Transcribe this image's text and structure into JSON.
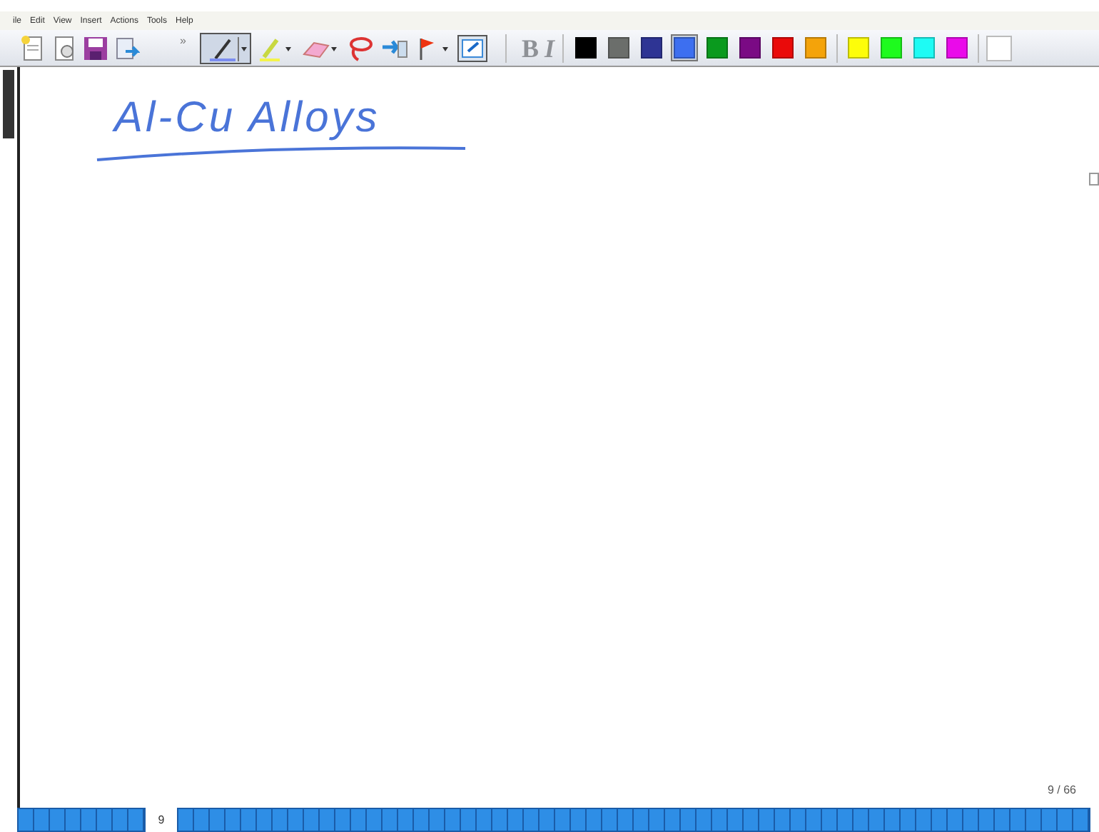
{
  "menu": [
    "ile",
    "Edit",
    "View",
    "Insert",
    "Actions",
    "Tools",
    "Help"
  ],
  "toolbar": {
    "overflow": "»",
    "pen_selected": true,
    "bold": "B",
    "italic": "I"
  },
  "palette": [
    {
      "color": "#000000",
      "selected": false
    },
    {
      "color": "#6b6e6b",
      "selected": false
    },
    {
      "color": "#2e3494",
      "selected": false
    },
    {
      "color": "#3d6ff0",
      "selected": true
    },
    {
      "color": "#0a9a1e",
      "selected": false
    },
    {
      "color": "#7a0a84",
      "selected": false
    },
    {
      "color": "#ea0a0a",
      "selected": false
    },
    {
      "color": "#f4a30a",
      "selected": false
    },
    {
      "color": "#fdfd0a",
      "selected": false
    },
    {
      "color": "#1efb1e",
      "selected": false
    },
    {
      "color": "#1efbf4",
      "selected": false
    },
    {
      "color": "#ea0aea",
      "selected": false
    }
  ],
  "note": {
    "title": "Al-Cu Alloys"
  },
  "page_counter": "9 / 66",
  "page_strip": {
    "current": "9"
  }
}
